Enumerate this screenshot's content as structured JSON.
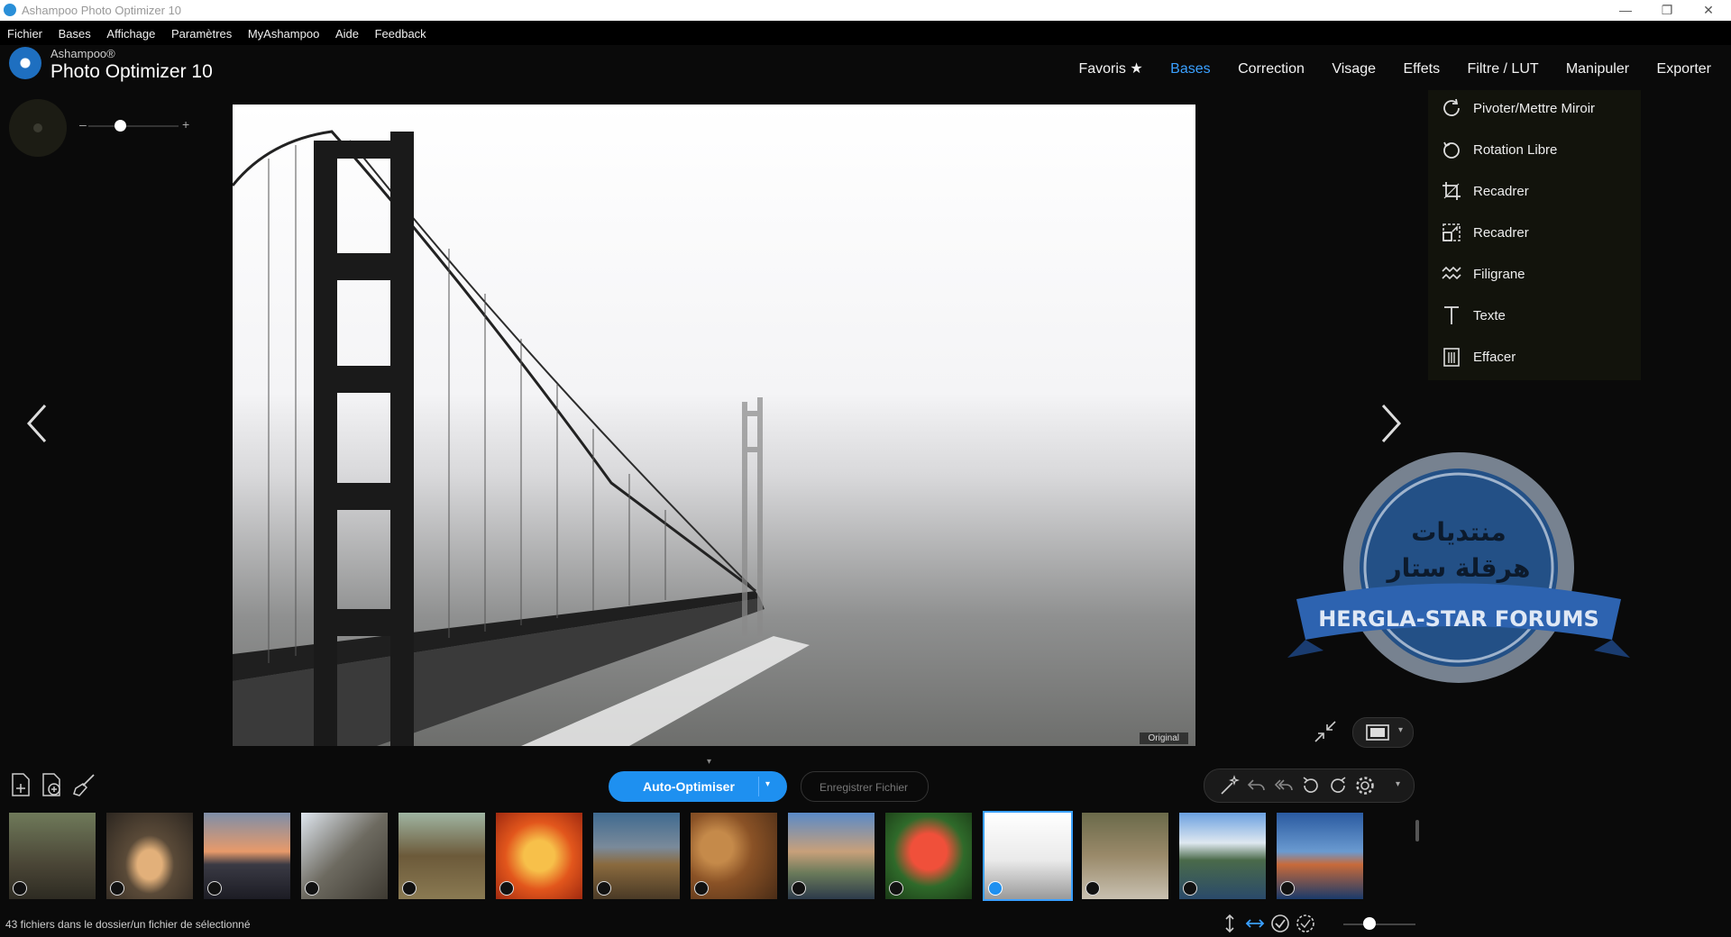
{
  "window": {
    "title": "Ashampoo Photo Optimizer 10",
    "minimize_glyph": "—",
    "restore_glyph": "❐",
    "close_glyph": "✕"
  },
  "menu": [
    "Fichier",
    "Bases",
    "Affichage",
    "Paramètres",
    "MyAshampoo",
    "Aide",
    "Feedback"
  ],
  "brand": {
    "company": "Ashampoo®",
    "product": "Photo Optimizer 10"
  },
  "topnav": [
    {
      "label": "Favoris ★",
      "active": false
    },
    {
      "label": "Bases",
      "active": true
    },
    {
      "label": "Correction",
      "active": false
    },
    {
      "label": "Visage",
      "active": false
    },
    {
      "label": "Effets",
      "active": false
    },
    {
      "label": "Filtre / LUT",
      "active": false
    },
    {
      "label": "Manipuler",
      "active": false
    },
    {
      "label": "Exporter",
      "active": false
    }
  ],
  "zoom": {
    "minus": "–",
    "plus": "+",
    "level": 0.3
  },
  "tools": [
    {
      "label": "Pivoter/Mettre Miroir",
      "icon": "rotate-mirror-icon"
    },
    {
      "label": "Rotation Libre",
      "icon": "free-rotation-icon"
    },
    {
      "label": "Recadrer",
      "icon": "crop-icon"
    },
    {
      "label": "Recadrer",
      "icon": "resize-icon"
    },
    {
      "label": "Filigrane",
      "icon": "watermark-icon"
    },
    {
      "label": "Texte",
      "icon": "text-icon"
    },
    {
      "label": "Effacer",
      "icon": "erase-icon"
    }
  ],
  "viewer": {
    "original_label": "Original"
  },
  "actions": {
    "auto_optimize": "Auto-Optimiser",
    "save_file": "Enregistrer Fichier",
    "caret": "▾"
  },
  "thumbnails": [
    {
      "name": "temple-ruins",
      "checked": false
    },
    {
      "name": "cat",
      "checked": false
    },
    {
      "name": "sunset-lake",
      "checked": false
    },
    {
      "name": "tree-branch",
      "checked": false
    },
    {
      "name": "horse",
      "checked": false
    },
    {
      "name": "orange-leaf",
      "checked": false
    },
    {
      "name": "coast-rocks",
      "checked": false
    },
    {
      "name": "nuts",
      "checked": false
    },
    {
      "name": "coastal-village",
      "checked": false
    },
    {
      "name": "flowers",
      "checked": false
    },
    {
      "name": "golden-gate-bridge",
      "checked": true,
      "selected": true
    },
    {
      "name": "squirrel",
      "checked": false
    },
    {
      "name": "mountain-lake",
      "checked": false
    },
    {
      "name": "harbor-houses",
      "checked": false
    }
  ],
  "status": {
    "text": "43 fichiers dans le dossier/un fichier de sélectionné",
    "thumb_zoom": 0.35
  },
  "watermark": {
    "arabic_line1": "منتديات",
    "arabic_line2": "هرقلة ستار",
    "ribbon": "HERGLA-STAR FORUMS"
  },
  "colors": {
    "accent": "#1e90f0",
    "active_tab": "#3aa0ff",
    "panel_bg": "#12130c"
  }
}
